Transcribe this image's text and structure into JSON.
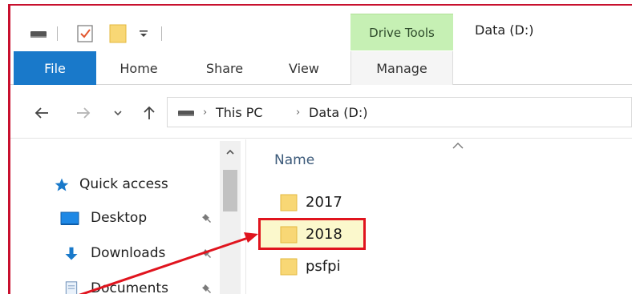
{
  "ribbon": {
    "context_tab_group": "Drive Tools",
    "tabs": [
      {
        "label": "File"
      },
      {
        "label": "Home"
      },
      {
        "label": "Share"
      },
      {
        "label": "View"
      },
      {
        "label": "Manage"
      }
    ]
  },
  "window": {
    "title": "Data (D:)"
  },
  "address_bar": {
    "breadcrumbs": [
      "This PC",
      "Data (D:)"
    ]
  },
  "nav_pane": {
    "items": [
      {
        "label": "Quick access",
        "icon": "star-icon"
      },
      {
        "label": "Desktop",
        "icon": "desktop-icon",
        "pinned": true
      },
      {
        "label": "Downloads",
        "icon": "download-arrow-icon",
        "pinned": true
      },
      {
        "label": "Documents",
        "icon": "document-icon",
        "pinned": true
      }
    ]
  },
  "content": {
    "column_header": "Name",
    "files": [
      {
        "label": "2017",
        "icon": "folder-icon"
      },
      {
        "label": "2018",
        "icon": "folder-icon",
        "highlighted": true
      },
      {
        "label": "psfpi",
        "icon": "folder-icon"
      }
    ]
  },
  "colors": {
    "accent_blue": "#1979ca",
    "drive_tools_green": "#c6f0b4",
    "highlight_red": "#e0141e",
    "folder_yellow": "#f8d775"
  }
}
